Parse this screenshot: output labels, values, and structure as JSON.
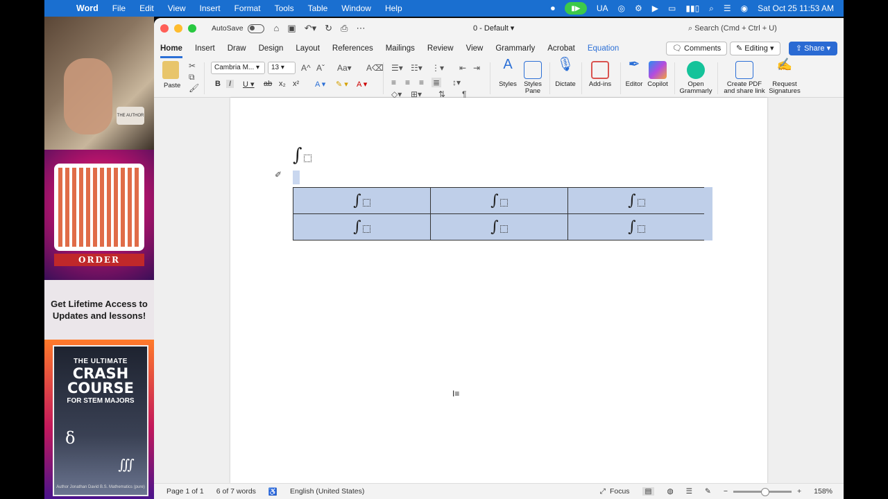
{
  "menubar": {
    "app": "Word",
    "items": [
      "File",
      "Edit",
      "View",
      "Insert",
      "Format",
      "Tools",
      "Table",
      "Window",
      "Help"
    ],
    "input_source": "UA",
    "datetime": "Sat Oct 25  11:53 AM"
  },
  "sidebar": {
    "order_label": "ORDER",
    "promo_text": "Get Lifetime Access to Updates and lessons!",
    "book": {
      "line1": "THE ULTIMATE",
      "line2": "CRASH COURSE",
      "line3": "FOR STEM MAJORS",
      "author": "Author Jonathan David B.S. Mathematics (pure)"
    },
    "mic_text": "THE AUTHOR"
  },
  "titlebar": {
    "autosave_label": "AutoSave",
    "doc_title": "0 - Default",
    "search_placeholder": "Search (Cmd + Ctrl + U)"
  },
  "tabs": {
    "items": [
      "Home",
      "Insert",
      "Draw",
      "Design",
      "Layout",
      "References",
      "Mailings",
      "Review",
      "View",
      "Grammarly",
      "Acrobat",
      "Equation"
    ],
    "comments": "Comments",
    "editing": "Editing",
    "share": "Share"
  },
  "ribbon": {
    "paste": "Paste",
    "font_name": "Cambria M...",
    "font_size": "13",
    "styles": "Styles",
    "styles_pane": "Styles Pane",
    "dictate": "Dictate",
    "addins": "Add-ins",
    "editor": "Editor",
    "copilot": "Copilot",
    "open_grammarly": "Open Grammarly",
    "create_pdf": "Create PDF and share link",
    "request_signatures": "Request Signatures"
  },
  "document": {
    "integral_symbol": "∫"
  },
  "statusbar": {
    "page": "Page 1 of 1",
    "words": "6 of 7 words",
    "language": "English (United States)",
    "focus": "Focus",
    "zoom_minus": "−",
    "zoom_plus": "+",
    "zoom": "158%"
  },
  "colors": {
    "menubar": "#1a6fd0",
    "accent": "#2b6fd6",
    "selection": "#bfcfe9"
  }
}
